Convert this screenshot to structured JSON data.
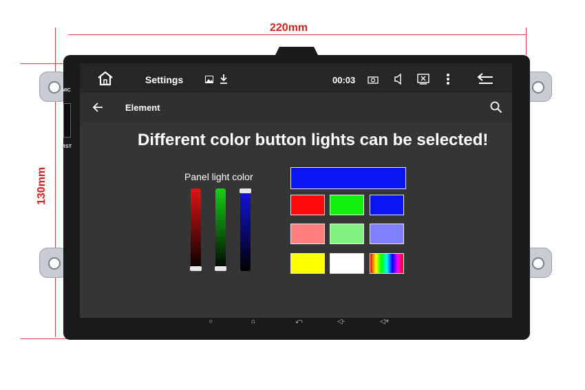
{
  "dimensions": {
    "width_label": "220mm",
    "height_label": "130mm"
  },
  "device": {
    "mic_label": "MIC",
    "rst_label": "RST"
  },
  "status_bar": {
    "home_icon": "home-icon",
    "title": "Settings",
    "notification_icons": [
      "image-icon",
      "download-icon"
    ],
    "time": "00:03",
    "icons": [
      "camera-icon",
      "volume-icon",
      "close-window-icon",
      "more-vert-icon",
      "back-return-icon"
    ]
  },
  "app_bar": {
    "back_icon": "arrow-left-icon",
    "title": "Element",
    "search_icon": "search-icon"
  },
  "headline": "Different color button lights can be selected!",
  "panel": {
    "label": "Panel light color",
    "sliders": [
      {
        "name": "red",
        "color": "#e01414",
        "level": 0.0
      },
      {
        "name": "green",
        "color": "#16d016",
        "level": 0.0
      },
      {
        "name": "blue",
        "color": "#1414e0",
        "level": 1.0
      }
    ]
  },
  "swatches": {
    "preview": "#0a14f0",
    "grid": [
      [
        "#ff0a0a",
        "#10ee10",
        "#0a14f0"
      ],
      [
        "#ff7f7f",
        "#80f080",
        "#8080ff"
      ],
      [
        "#ffff00",
        "#ffffff",
        "spectrum"
      ]
    ]
  },
  "nav_bar": [
    "circle-icon",
    "home-icon",
    "return-icon",
    "volume-down-icon",
    "volume-up-icon"
  ]
}
